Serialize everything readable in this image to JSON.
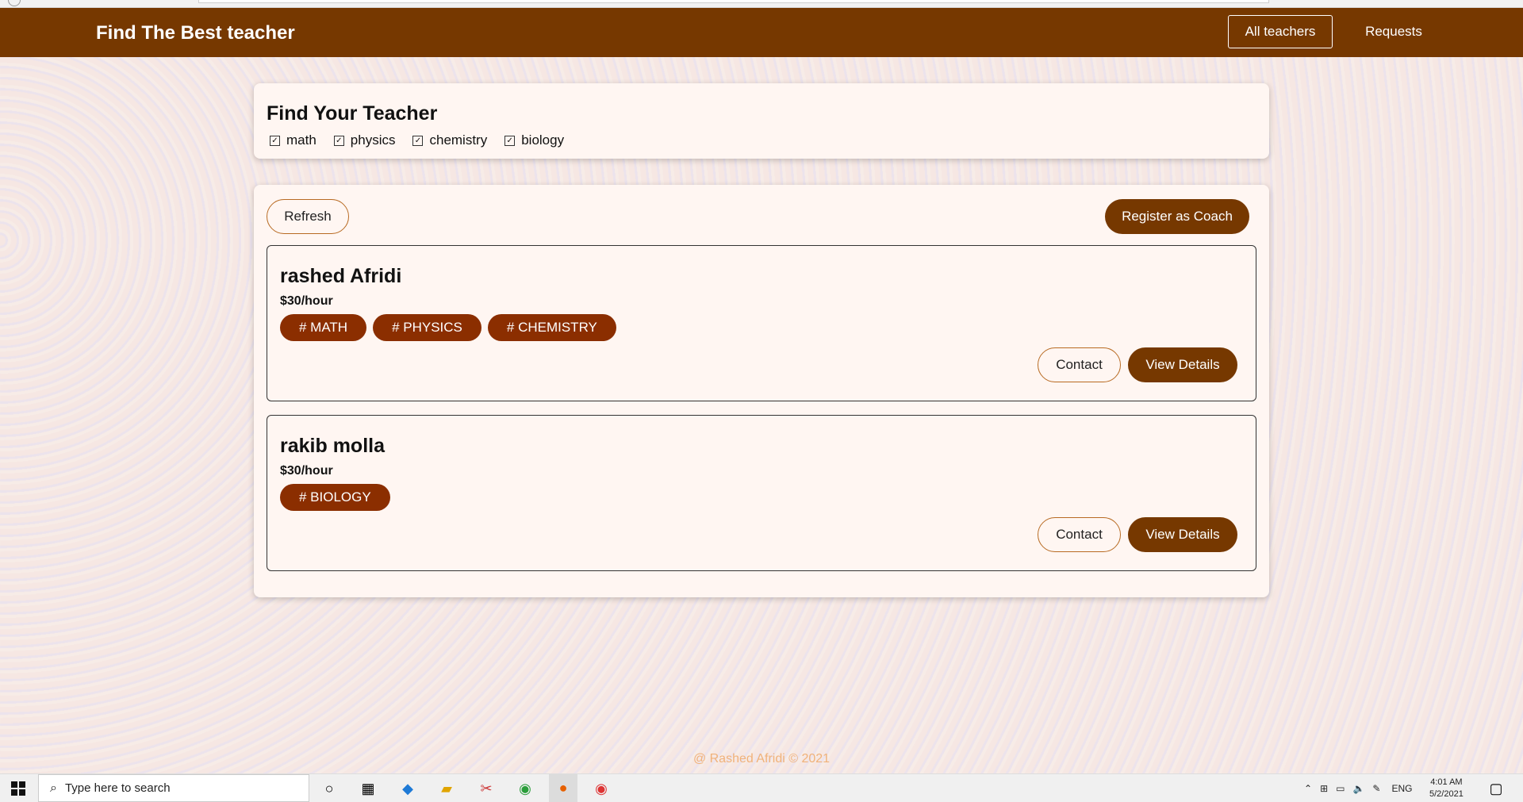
{
  "app": {
    "brand": "Find The Best teacher"
  },
  "nav": {
    "all_teachers": "All teachers",
    "requests": "Requests"
  },
  "filter": {
    "title": "Find Your Teacher",
    "options": [
      {
        "label": "math",
        "checked": true
      },
      {
        "label": "physics",
        "checked": true
      },
      {
        "label": "chemistry",
        "checked": true
      },
      {
        "label": "biology",
        "checked": true
      }
    ]
  },
  "actions": {
    "refresh": "Refresh",
    "register": "Register as Coach"
  },
  "teachers": [
    {
      "name": "rashed Afridi",
      "rate": "$30/hour",
      "tags": [
        "# MATH",
        "# PHYSICS",
        "# CHEMISTRY"
      ],
      "contact": "Contact",
      "details": "View Details"
    },
    {
      "name": "rakib molla",
      "rate": "$30/hour",
      "tags": [
        "# BIOLOGY"
      ],
      "contact": "Contact",
      "details": "View Details"
    }
  ],
  "footer": "@ Rashed Afridi © 2021",
  "taskbar": {
    "search_placeholder": "Type here to search",
    "lang": "ENG",
    "time": "4:01 AM",
    "date": "5/2/2021"
  },
  "colors": {
    "primary": "#763800",
    "tag": "#8b2e00",
    "card": "#fff6f2",
    "footer_text": "#f0b27a"
  }
}
